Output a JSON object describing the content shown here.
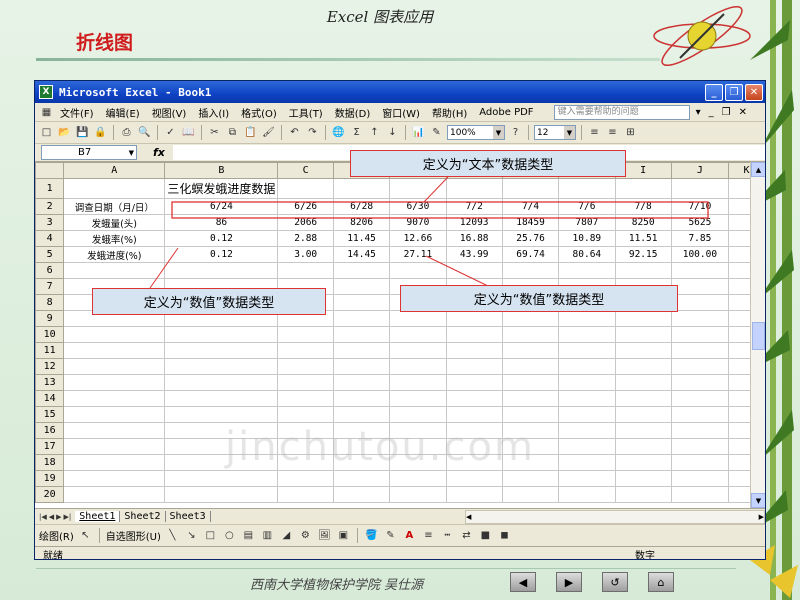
{
  "slide": {
    "header_title": "Excel 图表应用",
    "heading": "折线图",
    "footer": "西南大学植物保护学院 吴仕源",
    "watermark": "jinchutou.com"
  },
  "window": {
    "title": "Microsoft Excel - Book1"
  },
  "menu": {
    "items": [
      "文件(F)",
      "编辑(E)",
      "视图(V)",
      "插入(I)",
      "格式(O)",
      "工具(T)",
      "数据(D)",
      "窗口(W)",
      "帮助(H)",
      "Adobe PDF"
    ],
    "help_placeholder": "键入需要帮助的问题"
  },
  "toolbar": {
    "zoom": "100%",
    "font_size": "12"
  },
  "formula_bar": {
    "cell_ref": "B7",
    "fx": "fx"
  },
  "sheet": {
    "columns": [
      "A",
      "B",
      "C",
      "D",
      "E",
      "F",
      "G",
      "H",
      "I",
      "J",
      "K"
    ],
    "rows": [
      "1",
      "2",
      "3",
      "4",
      "5",
      "6",
      "7",
      "8",
      "9",
      "10",
      "11",
      "12",
      "13",
      "14",
      "15",
      "16",
      "17",
      "18",
      "19",
      "20"
    ],
    "title": "三化螟发蛾进度数据",
    "row2_label": "调查日期（月/日）",
    "row2": [
      "6/24",
      "6/26",
      "6/28",
      "6/30",
      "7/2",
      "7/4",
      "7/6",
      "7/8",
      "7/10"
    ],
    "row3_label": "发蛾量(头)",
    "row3": [
      "86",
      "2066",
      "8206",
      "9070",
      "12093",
      "18459",
      "7807",
      "8250",
      "5625"
    ],
    "row4_label": "发蛾率(%)",
    "row4": [
      "0.12",
      "2.88",
      "11.45",
      "12.66",
      "16.88",
      "25.76",
      "10.89",
      "11.51",
      "7.85"
    ],
    "row5_label": "发蛾进度(%)",
    "row5": [
      "0.12",
      "3.00",
      "14.45",
      "27.11",
      "43.99",
      "69.74",
      "80.64",
      "92.15",
      "100.00"
    ]
  },
  "tabs": [
    "Sheet1",
    "Sheet2",
    "Sheet3"
  ],
  "draw_toolbar": {
    "draw": "绘图(R)",
    "autoshapes": "自选图形(U)"
  },
  "status": {
    "ready": "就绪",
    "mode": "数字"
  },
  "callouts": {
    "text_type": "定义为“文本”数据类型",
    "value_type_left": "定义为“数值”数据类型",
    "value_type_right": "定义为“数值”数据类型"
  },
  "colors": {
    "heading": "#d01c1c",
    "titlebar": "#0f43c4",
    "callout_border": "#dd3333"
  }
}
